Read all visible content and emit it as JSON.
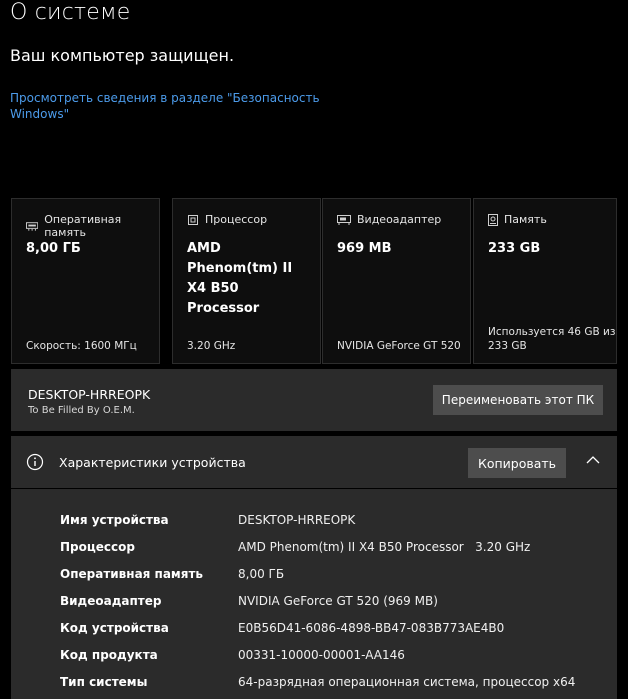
{
  "header": {
    "title": "О системе",
    "protected_text": "Ваш компьютер защищен.",
    "security_link": "Просмотреть сведения в разделе \"Безопасность Windows\""
  },
  "cards": [
    {
      "icon": "memory-icon",
      "label": "Оперативная память",
      "value": "8,00 ГБ",
      "detail": "Скорость: 1600 МГц"
    },
    {
      "icon": "processor-icon",
      "label": "Процессор",
      "value": "AMD Phenom(tm) II X4 B50 Processor",
      "detail": "3.20 GHz"
    },
    {
      "icon": "display-adapter-icon",
      "label": "Видеоадаптер",
      "value": "969 MB",
      "detail": "NVIDIA GeForce GT 520"
    },
    {
      "icon": "storage-icon",
      "label": "Память",
      "value": "233 GB",
      "detail": "Используется 46 GB из 233 GB"
    }
  ],
  "pc": {
    "name": "DESKTOP-HRREOPK",
    "oem": "To Be Filled By O.E.M.",
    "rename_label": "Переименовать этот ПК"
  },
  "specs": {
    "title": "Характеристики устройства",
    "copy_label": "Копировать",
    "rows": [
      {
        "key": "Имя устройства",
        "value": "DESKTOP-HRREOPK"
      },
      {
        "key": "Процессор",
        "value": "AMD Phenom(tm) II X4 B50 Processor   3.20 GHz"
      },
      {
        "key": "Оперативная память",
        "value": "8,00 ГБ"
      },
      {
        "key": "Видеоадаптер",
        "value": "NVIDIA GeForce GT 520 (969 MB)"
      },
      {
        "key": "Код устройства",
        "value": "E0B56D41-6086-4898-BB47-083B773AE4B0"
      },
      {
        "key": "Код продукта",
        "value": "00331-10000-00001-AA146"
      },
      {
        "key": "Тип системы",
        "value": "64-разрядная операционная система, процессор x64"
      }
    ]
  },
  "colors": {
    "background": "#000000",
    "panel": "#2b2b2b",
    "button": "#4d4d4d",
    "link": "#4c9bea"
  }
}
